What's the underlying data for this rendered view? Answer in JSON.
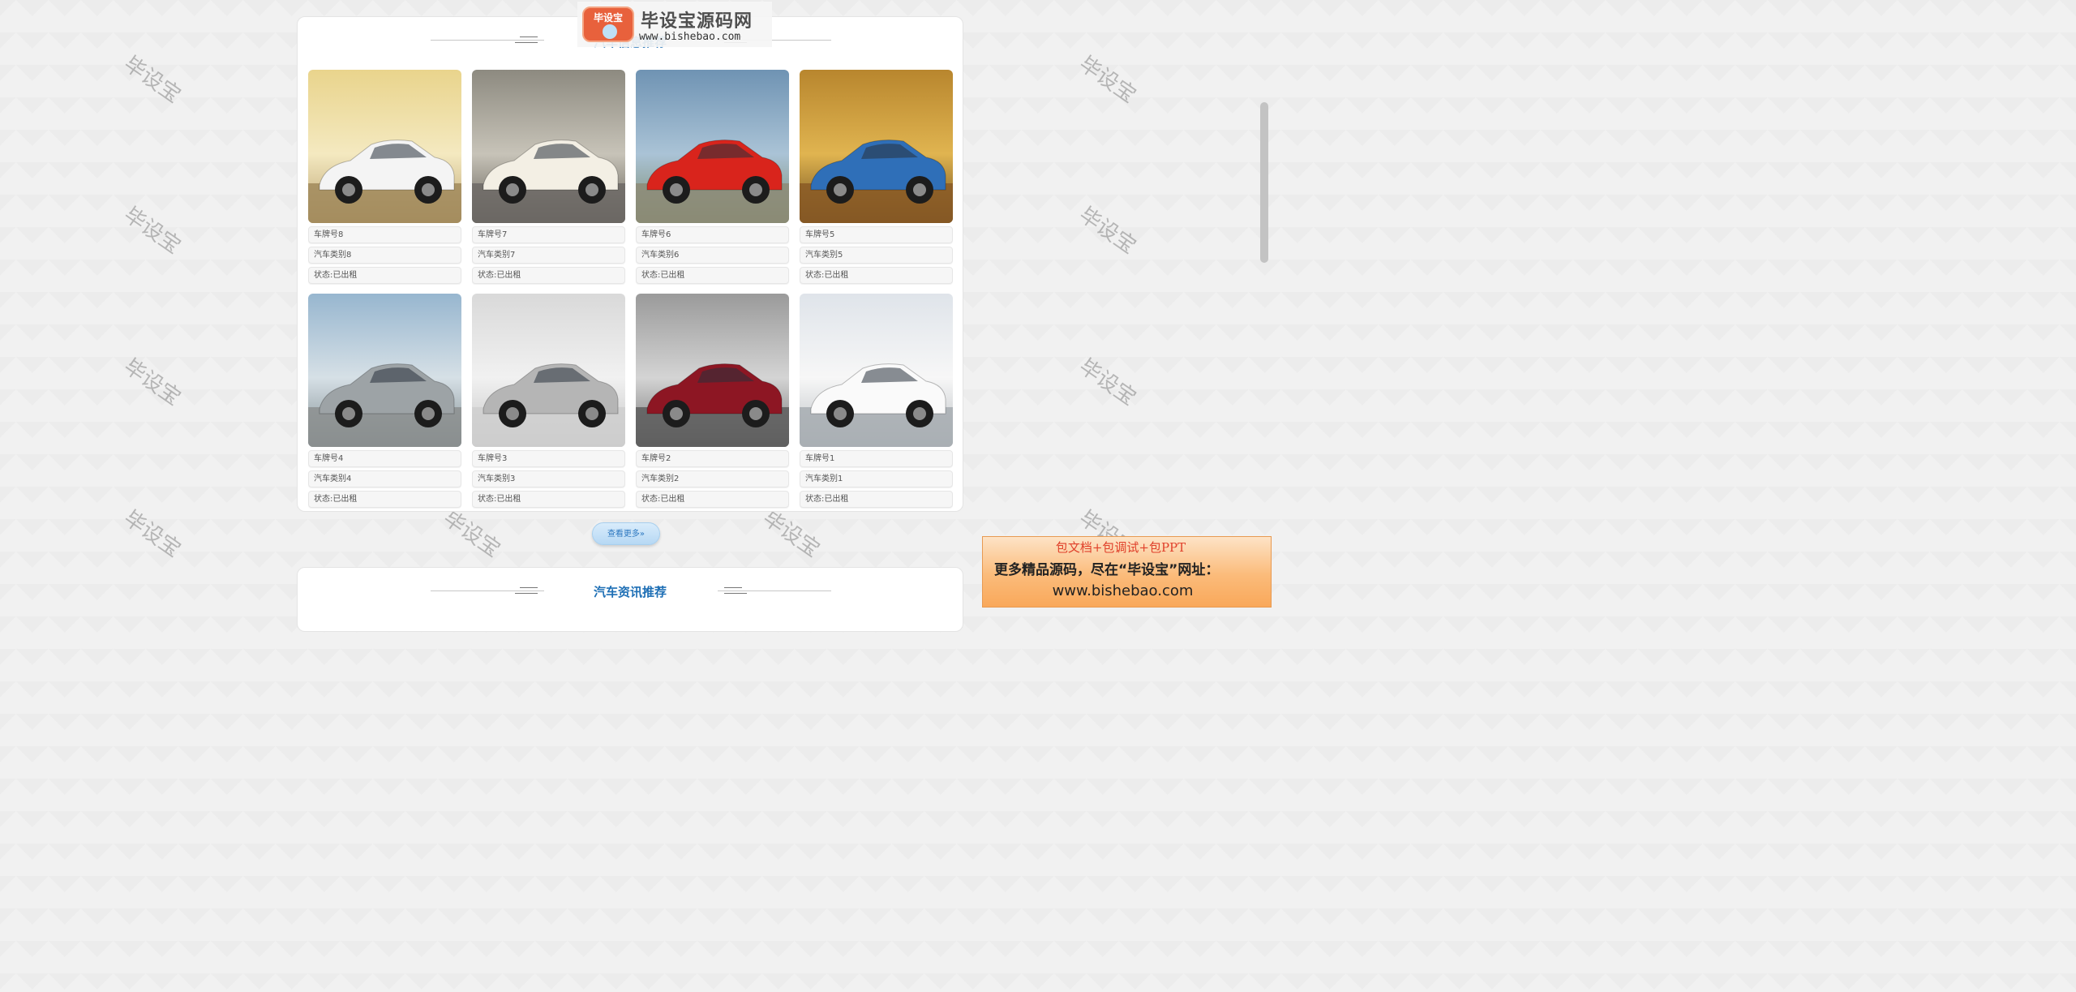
{
  "logo": {
    "badge_text": "毕设宝",
    "site_name": "毕设宝源码网",
    "url": "www.bishebao.com"
  },
  "sections": {
    "recommend_title": "汽车信息推荐",
    "recommend_title_overlap": "www.",
    "news_title": "汽车资讯推荐"
  },
  "cars": [
    {
      "plate": "车牌号8",
      "type": "汽车类别8",
      "status": "状态:已出租",
      "image": "white convertible at sunset"
    },
    {
      "plate": "车牌号7",
      "type": "汽车类别7",
      "status": "状态:已出租",
      "image": "white suv on street"
    },
    {
      "plate": "车牌号6",
      "type": "汽车类别6",
      "status": "状态:已出租",
      "image": "red sports car by mountains"
    },
    {
      "plate": "车牌号5",
      "type": "汽车类别5",
      "status": "状态:已出租",
      "image": "blue coupe in autumn forest"
    },
    {
      "plate": "车牌号4",
      "type": "汽车类别4",
      "status": "状态:已出租",
      "image": "silver sedan near bridge"
    },
    {
      "plate": "车牌号3",
      "type": "汽车类别3",
      "status": "状态:已出租",
      "image": "silver concept car"
    },
    {
      "plate": "车牌号2",
      "type": "汽车类别2",
      "status": "状态:已出租",
      "image": "red supercar"
    },
    {
      "plate": "车牌号1",
      "type": "汽车类别1",
      "status": "状态:已出租",
      "image": "white suv"
    }
  ],
  "more_button": "查看更多»",
  "watermark_text": "毕设宝",
  "ad": {
    "line1": "包文档+包调试+包PPT",
    "line2": "更多精品源码，尽在“毕设宝”网址：",
    "line3": "www.bishebao.com"
  },
  "colors": {
    "title": "#1e6fb5",
    "button": "#b6d8f4",
    "ad_bg": "#fbbb7a",
    "ad_red": "#e0402a"
  }
}
